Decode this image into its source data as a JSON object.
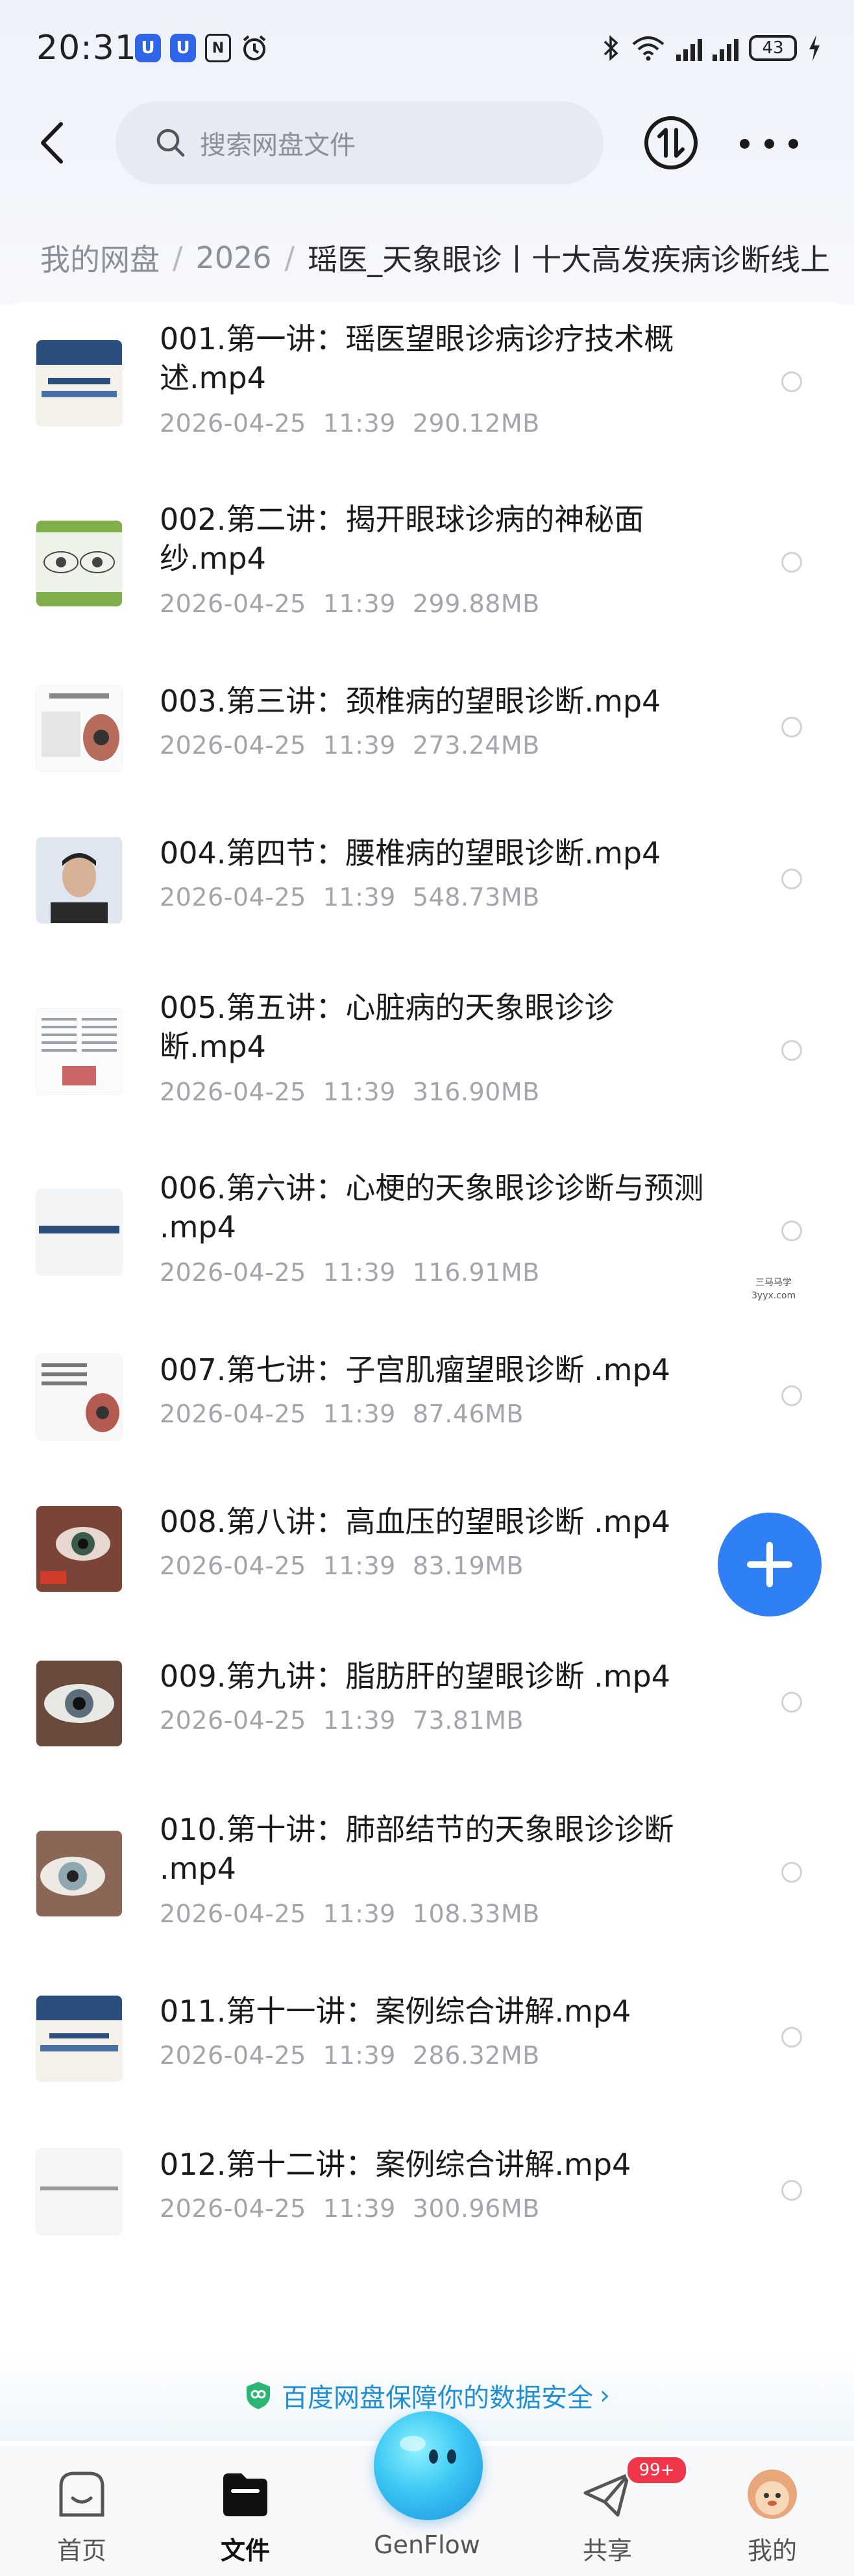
{
  "status_bar": {
    "time": "20:31",
    "notif_icons": [
      "U",
      "U",
      "N"
    ],
    "battery": "43"
  },
  "header": {
    "search_placeholder": "搜索网盘文件"
  },
  "breadcrumb": [
    "我的网盘",
    "2026",
    "瑶医_天象眼诊丨十大高发疾病诊断线上"
  ],
  "files": [
    {
      "name": "001.第一讲：瑶医望眼诊病诊疗技术概述.mp4",
      "date": "2026-04-25",
      "time": "11:39",
      "size": "290.12MB",
      "thumb": "slide-title"
    },
    {
      "name": "002.第二讲：揭开眼球诊病的神秘面纱.mp4",
      "date": "2026-04-25",
      "time": "11:39",
      "size": "299.88MB",
      "thumb": "eye-diagram"
    },
    {
      "name": "003.第三讲：颈椎病的望眼诊断.mp4",
      "date": "2026-04-25",
      "time": "11:39",
      "size": "273.24MB",
      "thumb": "slide-eye"
    },
    {
      "name": "004.第四节：腰椎病的望眼诊断.mp4",
      "date": "2026-04-25",
      "time": "11:39",
      "size": "548.73MB",
      "thumb": "person"
    },
    {
      "name": "005.第五讲：心脏病的天象眼诊诊断.mp4",
      "date": "2026-04-25",
      "time": "11:39",
      "size": "316.90MB",
      "thumb": "text-slide"
    },
    {
      "name": "006.第六讲：心梗的天象眼诊诊断与预测 .mp4",
      "date": "2026-04-25",
      "time": "11:39",
      "size": "116.91MB",
      "thumb": "slide-blue-text"
    },
    {
      "name": "007.第七讲：子宫肌瘤望眼诊断 .mp4",
      "date": "2026-04-25",
      "time": "11:39",
      "size": "87.46MB",
      "thumb": "slide-eye2"
    },
    {
      "name": "008.第八讲：高血压的望眼诊断 .mp4",
      "date": "2026-04-25",
      "time": "11:39",
      "size": "83.19MB",
      "thumb": "eye-red"
    },
    {
      "name": "009.第九讲：脂肪肝的望眼诊断 .mp4",
      "date": "2026-04-25",
      "time": "11:39",
      "size": "73.81MB",
      "thumb": "eye-close"
    },
    {
      "name": "010.第十讲：肺部结节的天象眼诊诊断 .mp4",
      "date": "2026-04-25",
      "time": "11:39",
      "size": "108.33MB",
      "thumb": "eye-close2"
    },
    {
      "name": "011.第十一讲：案例综合讲解.mp4",
      "date": "2026-04-25",
      "time": "11:39",
      "size": "286.32MB",
      "thumb": "slide-title2"
    },
    {
      "name": "012.第十二讲：案例综合讲解.mp4",
      "date": "2026-04-25",
      "time": "11:39",
      "size": "300.96MB",
      "thumb": "slide-plain"
    }
  ],
  "watermark": [
    "三马马学",
    "3yyx.com"
  ],
  "security_banner": {
    "text": "百度网盘保障你的数据安全",
    "arrow": "›"
  },
  "tabbar": {
    "tabs": [
      {
        "label": "首页",
        "icon": "home-icon"
      },
      {
        "label": "文件",
        "icon": "folder-icon",
        "active": true
      },
      {
        "label": "GenFlow",
        "icon": "genflow-icon"
      },
      {
        "label": "共享",
        "icon": "share-icon"
      },
      {
        "label": "我的",
        "icon": "avatar-icon"
      }
    ],
    "share_badge": "99+"
  },
  "colors": {
    "accent": "#2f7ff5",
    "security": "#1f8fd6",
    "badge": "#f2364a"
  }
}
